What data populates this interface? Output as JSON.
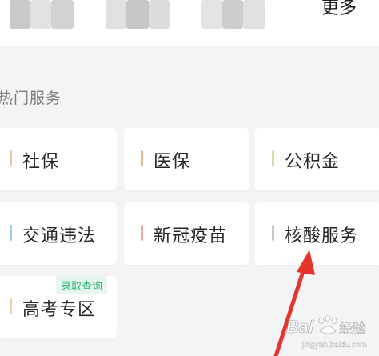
{
  "top_bar": {
    "more_label": "更多"
  },
  "section": {
    "title": "热门服务"
  },
  "services": [
    {
      "label": "社保",
      "accent": "#e8c8a0"
    },
    {
      "label": "医保",
      "accent": "#e8b88c"
    },
    {
      "label": "公积金",
      "accent": "#cfe2a4"
    },
    {
      "label": "交通违法",
      "accent": "#9ccbe6"
    },
    {
      "label": "新冠疫苗",
      "accent": "#e6a8a4"
    },
    {
      "label": "核酸服务",
      "accent": "#c8c8c8"
    },
    {
      "label": "高考专区",
      "accent": "#e8d0a0",
      "badge": "录取查询"
    }
  ],
  "colors": {
    "background": "#f3f4f6",
    "card": "#ffffff",
    "badge_text": "#2bb673",
    "badge_bg": "#e7f6ee",
    "arrow": "#e8322c"
  },
  "watermark": {
    "brand": "Bai",
    "suffix": "经验",
    "url": "jingyan.baidu.com"
  }
}
